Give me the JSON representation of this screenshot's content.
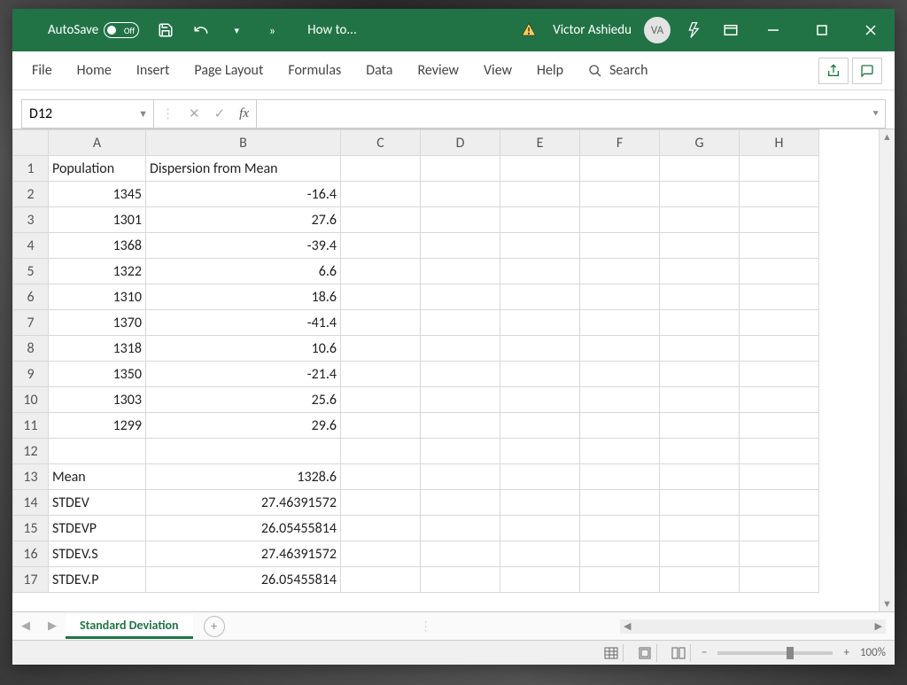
{
  "titlebar": {
    "autosave_label": "AutoSave",
    "autosave_state": "Off",
    "doc_title": "How to...",
    "user_name": "Victor Ashiedu",
    "user_initials": "VA"
  },
  "ribbon": {
    "tabs": [
      "File",
      "Home",
      "Insert",
      "Page Layout",
      "Formulas",
      "Data",
      "Review",
      "View",
      "Help"
    ],
    "search_label": "Search"
  },
  "namebox": {
    "value": "D12"
  },
  "formula": {
    "value": ""
  },
  "columns": [
    "A",
    "B",
    "C",
    "D",
    "E",
    "F",
    "G",
    "H"
  ],
  "headers": {
    "A": "Population",
    "B": "Dispersion from Mean"
  },
  "rows": [
    {
      "n": 2,
      "A": "1345",
      "B": "-16.4"
    },
    {
      "n": 3,
      "A": "1301",
      "B": "27.6"
    },
    {
      "n": 4,
      "A": "1368",
      "B": "-39.4"
    },
    {
      "n": 5,
      "A": "1322",
      "B": "6.6"
    },
    {
      "n": 6,
      "A": "1310",
      "B": "18.6"
    },
    {
      "n": 7,
      "A": "1370",
      "B": "-41.4"
    },
    {
      "n": 8,
      "A": "1318",
      "B": "10.6"
    },
    {
      "n": 9,
      "A": "1350",
      "B": "-21.4"
    },
    {
      "n": 10,
      "A": "1303",
      "B": "25.6"
    },
    {
      "n": 11,
      "A": "1299",
      "B": "29.6"
    }
  ],
  "summary": [
    {
      "n": 13,
      "label": "Mean",
      "value": "1328.6"
    },
    {
      "n": 14,
      "label": "STDEV",
      "value": "27.46391572"
    },
    {
      "n": 15,
      "label": "STDEVP",
      "value": "26.05455814"
    },
    {
      "n": 16,
      "label": "STDEV.S",
      "value": "27.46391572"
    },
    {
      "n": 17,
      "label": "STDEV.P",
      "value": "26.05455814"
    }
  ],
  "sheet_tab": "Standard Deviation",
  "status": {
    "zoom": "100%"
  },
  "chart_data": {
    "type": "table",
    "title": "Dispersion from Mean",
    "columns": [
      "Population",
      "Dispersion from Mean"
    ],
    "data": [
      [
        1345,
        -16.4
      ],
      [
        1301,
        27.6
      ],
      [
        1368,
        -39.4
      ],
      [
        1322,
        6.6
      ],
      [
        1310,
        18.6
      ],
      [
        1370,
        -41.4
      ],
      [
        1318,
        10.6
      ],
      [
        1350,
        -21.4
      ],
      [
        1303,
        25.6
      ],
      [
        1299,
        29.6
      ]
    ],
    "stats": {
      "Mean": 1328.6,
      "STDEV": 27.46391572,
      "STDEVP": 26.05455814,
      "STDEV.S": 27.46391572,
      "STDEV.P": 26.05455814
    }
  }
}
